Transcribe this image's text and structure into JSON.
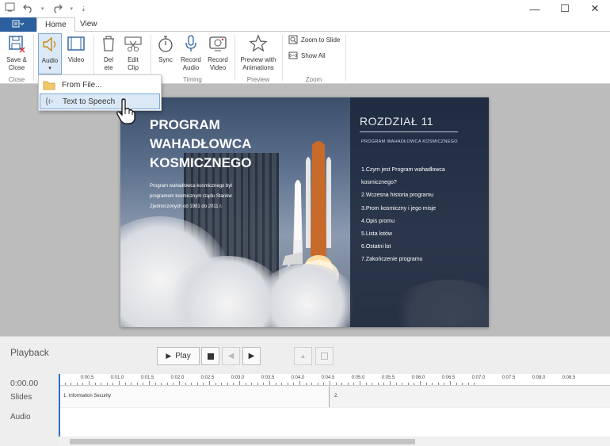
{
  "tabs": {
    "file_icon": "menu-icon",
    "home": "Home",
    "view": "View"
  },
  "ribbon": {
    "buttons": {
      "save_close": [
        "Save &",
        "Close"
      ],
      "audio": "Audio",
      "video": "Video",
      "delete": [
        "Del",
        "ete"
      ],
      "edit_clip": [
        "Edit",
        "Clip"
      ],
      "sync": "Sync",
      "record_audio": [
        "Record",
        "Audio"
      ],
      "record_video": [
        "Record",
        "Video"
      ],
      "preview": [
        "Preview with",
        "Animations"
      ],
      "zoom_to_slide": "Zoom to Slide",
      "show_all": "Show All"
    },
    "groups": {
      "close": "Close",
      "timing": "Timing",
      "preview": "Preview",
      "zoom": "Zoom"
    }
  },
  "audio_menu": {
    "from_file": "From File...",
    "text_to_speech": "Text to Speech"
  },
  "slide": {
    "title": [
      "PROGRAM",
      "WAHADŁOWCA",
      "KOSMICZNEGO"
    ],
    "body": "Program wahadłowca kosmicznego był programem kosmicznym rządu Stanów Zjednoczonych od 1981 do 2011 r.",
    "panel_heading": "ROZDZIAŁ 11",
    "panel_subheading": "PROGRAM WAHADŁOWCA KOSMICZNEGO",
    "panel_items": [
      "1.Czym jest Program wahadłowca kosmicznego?",
      "2.Wczesna historia programu",
      "3.Prom kosmiczny i jego misje",
      "4.Opis promu",
      "5.Lista lotów",
      "6.Ostatni lot",
      "7.Zakończenie programu"
    ]
  },
  "playback": {
    "label": "Playback",
    "play": "Play",
    "time": "0:00.00",
    "track_slides": "Slides",
    "track_audio": "Audio",
    "ticks": [
      "0:00.5",
      "0:01.0",
      "0:01.5",
      "0:02.0",
      "0:02.5",
      "0:03.0",
      "0:03.5",
      "0:04.0",
      "0:04.5",
      "0:05.0",
      "0:05.5",
      "0:06.0",
      "0:06.5",
      "0:07.0",
      "0:07.5",
      "0:08.0",
      "0:08.5"
    ],
    "clips": [
      "1. Information Security",
      "2."
    ]
  },
  "colors": {
    "accent": "#2b5f9e",
    "menu_hover": "#dbe8f6",
    "slide_panel": "#1c263a"
  }
}
